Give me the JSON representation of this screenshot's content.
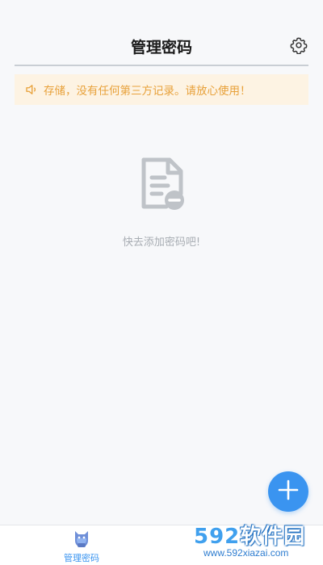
{
  "header": {
    "title": "管理密码"
  },
  "notice": {
    "text": "存储，没有任何第三方记录。请放心使用！"
  },
  "empty_state": {
    "text": "快去添加密码吧!"
  },
  "tabbar": {
    "items": [
      {
        "label": "管理密码",
        "active": true
      }
    ]
  },
  "watermark": {
    "brand_num": "592",
    "brand_text": "软件园",
    "url": "www.592xiazai.com"
  },
  "colors": {
    "accent": "#3a94f0",
    "notice_bg": "#fdf3e3",
    "notice_text": "#e8a13a"
  }
}
